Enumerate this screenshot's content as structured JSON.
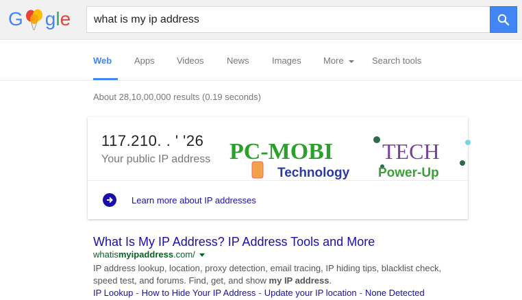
{
  "logo": {
    "g1": "G",
    "rest": "gle"
  },
  "search": {
    "value": "what is my ip address"
  },
  "tabs": [
    {
      "label": "Web"
    },
    {
      "label": "Apps"
    },
    {
      "label": "Videos"
    },
    {
      "label": "News"
    },
    {
      "label": "Images"
    },
    {
      "label": "More"
    },
    {
      "label": "Search tools"
    }
  ],
  "stats": "About 28,10,00,000 results (0.19 seconds)",
  "ip_card": {
    "ip": "117.210.  .  '  '26",
    "subtitle": "Your public IP address",
    "learn_more": "Learn more about IP addresses"
  },
  "watermark": {
    "pc_mobi": "PC-MOBI",
    "tech": "TECH",
    "tagline_left": "Technology",
    "tagline_right": "Power-Up"
  },
  "result": {
    "title": "What Is My IP Address? IP Address Tools and More",
    "url_prefix": "whatis",
    "url_bold": "myipaddress",
    "url_suffix": ".com/",
    "snippet_1": "IP address lookup, location, proxy detection, email tracing, IP hiding tips, blacklist check, speed test, and forums. Find, get, and show ",
    "snippet_bold": "my IP address",
    "snippet_end": ".",
    "sitelinks": [
      "IP Lookup",
      "How to Hide Your IP Address",
      "Update your IP location",
      "None Detected"
    ]
  },
  "colors": {
    "blue": "#4285f4",
    "link": "#1a0dab",
    "url_green": "#006621"
  }
}
